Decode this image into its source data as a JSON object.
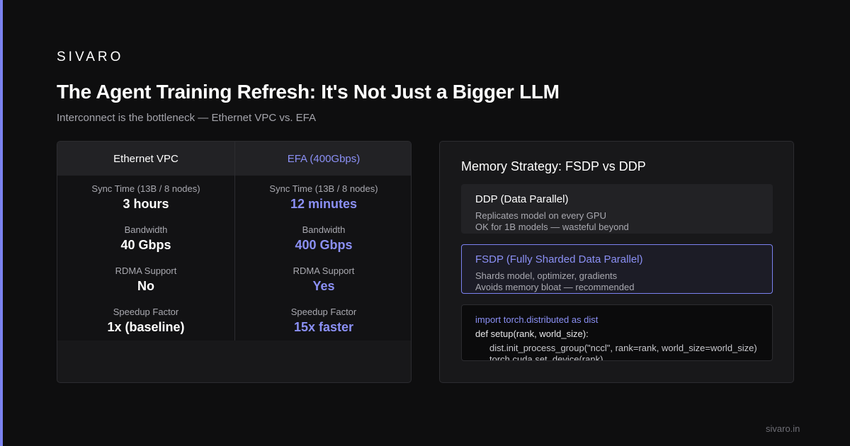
{
  "brand": "SIVARO",
  "title": "The Agent Training Refresh: It's Not Just a Bigger LLM",
  "subtitle": "Interconnect is the bottleneck — Ethernet VPC vs. EFA",
  "comparison": {
    "columns": [
      {
        "header": "Ethernet VPC",
        "metrics": [
          {
            "label": "Sync Time (13B / 8 nodes)",
            "value": "3 hours"
          },
          {
            "label": "Bandwidth",
            "value": "40 Gbps"
          },
          {
            "label": "RDMA Support",
            "value": "No"
          },
          {
            "label": "Speedup Factor",
            "value": "1x (baseline)"
          }
        ]
      },
      {
        "header": "EFA (400Gbps)",
        "metrics": [
          {
            "label": "Sync Time (13B / 8 nodes)",
            "value": "12 minutes"
          },
          {
            "label": "Bandwidth",
            "value": "400 Gbps"
          },
          {
            "label": "RDMA Support",
            "value": "Yes"
          },
          {
            "label": "Speedup Factor",
            "value": "15x faster"
          }
        ]
      }
    ]
  },
  "memory": {
    "title": "Memory Strategy: FSDP vs DDP",
    "options": [
      {
        "title": "DDP (Data Parallel)",
        "lines": [
          "Replicates model on every GPU",
          "OK for 1B models — wasteful beyond"
        ]
      },
      {
        "title": "FSDP (Fully Sharded Data Parallel)",
        "lines": [
          "Shards model, optimizer, gradients",
          "Avoids memory bloat — recommended"
        ]
      }
    ],
    "code": [
      "import torch.distributed as dist",
      "def setup(rank, world_size):",
      "dist.init_process_group(\"nccl\", rank=rank, world_size=world_size)",
      "torch.cuda.set_device(rank)"
    ]
  },
  "footer": "sivaro.in",
  "colors": {
    "accent": "#7b82f0",
    "background": "#0e0e0f",
    "card": "#18181a"
  }
}
